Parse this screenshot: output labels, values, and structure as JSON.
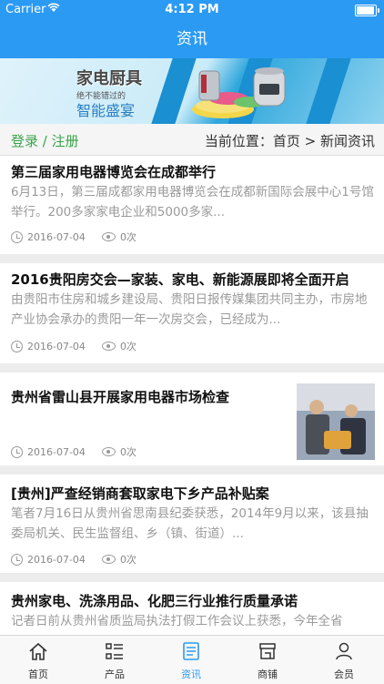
{
  "status_bar": {
    "carrier": "Carrier",
    "time": "4:12 PM"
  },
  "nav": {
    "title": "资讯"
  },
  "banner": {
    "title": "家电厨具",
    "subtitle": "绝不能错过的",
    "slogan": "智能盛宴"
  },
  "breadcrumb_bar": {
    "login": "登录 / 注册",
    "location": "当前位置：首页 > 新闻资讯"
  },
  "news": [
    {
      "title": "第三届家用电器博览会在成都举行",
      "summary": "6月13日，第三届成都家用电器博览会在成都新国际会展中心1号馆举行。200多家家电企业和5000多家...",
      "date": "2016-07-04",
      "views": "0次"
    },
    {
      "title": "2016贵阳房交会—家装、家电、新能源展即将全面开启",
      "summary": "由贵阳市住房和城乡建设局、贵阳日报传媒集团共同主办，市房地产业协会承办的贵阳一年一次房交会，已经成为...",
      "date": "2016-07-04",
      "views": "0次"
    },
    {
      "title": "贵州省雷山县开展家用电器市场检查",
      "summary": "",
      "date": "2016-07-04",
      "views": "0次"
    },
    {
      "title": "[贵州]严查经销商套取家电下乡产品补贴案",
      "summary": "笔者7月16日从贵州省思南县纪委获悉，2014年9月以来，该县抽委局机关、民生监督组、乡（镇、街道）...",
      "date": "2016-07-04",
      "views": "0次"
    },
    {
      "title": "贵州家电、洗涤用品、化肥三行业推行质量承诺",
      "summary": "记者日前从贵州省质监局执法打假工作会议上获悉，今年全省",
      "date": "",
      "views": ""
    }
  ],
  "tabs": [
    {
      "label": "首页",
      "icon": "home-icon"
    },
    {
      "label": "产品",
      "icon": "list-icon"
    },
    {
      "label": "资讯",
      "icon": "document-icon"
    },
    {
      "label": "商铺",
      "icon": "shop-icon"
    },
    {
      "label": "会员",
      "icon": "user-icon"
    }
  ],
  "colors": {
    "accent": "#2b9af3",
    "login": "#3aa34a"
  }
}
